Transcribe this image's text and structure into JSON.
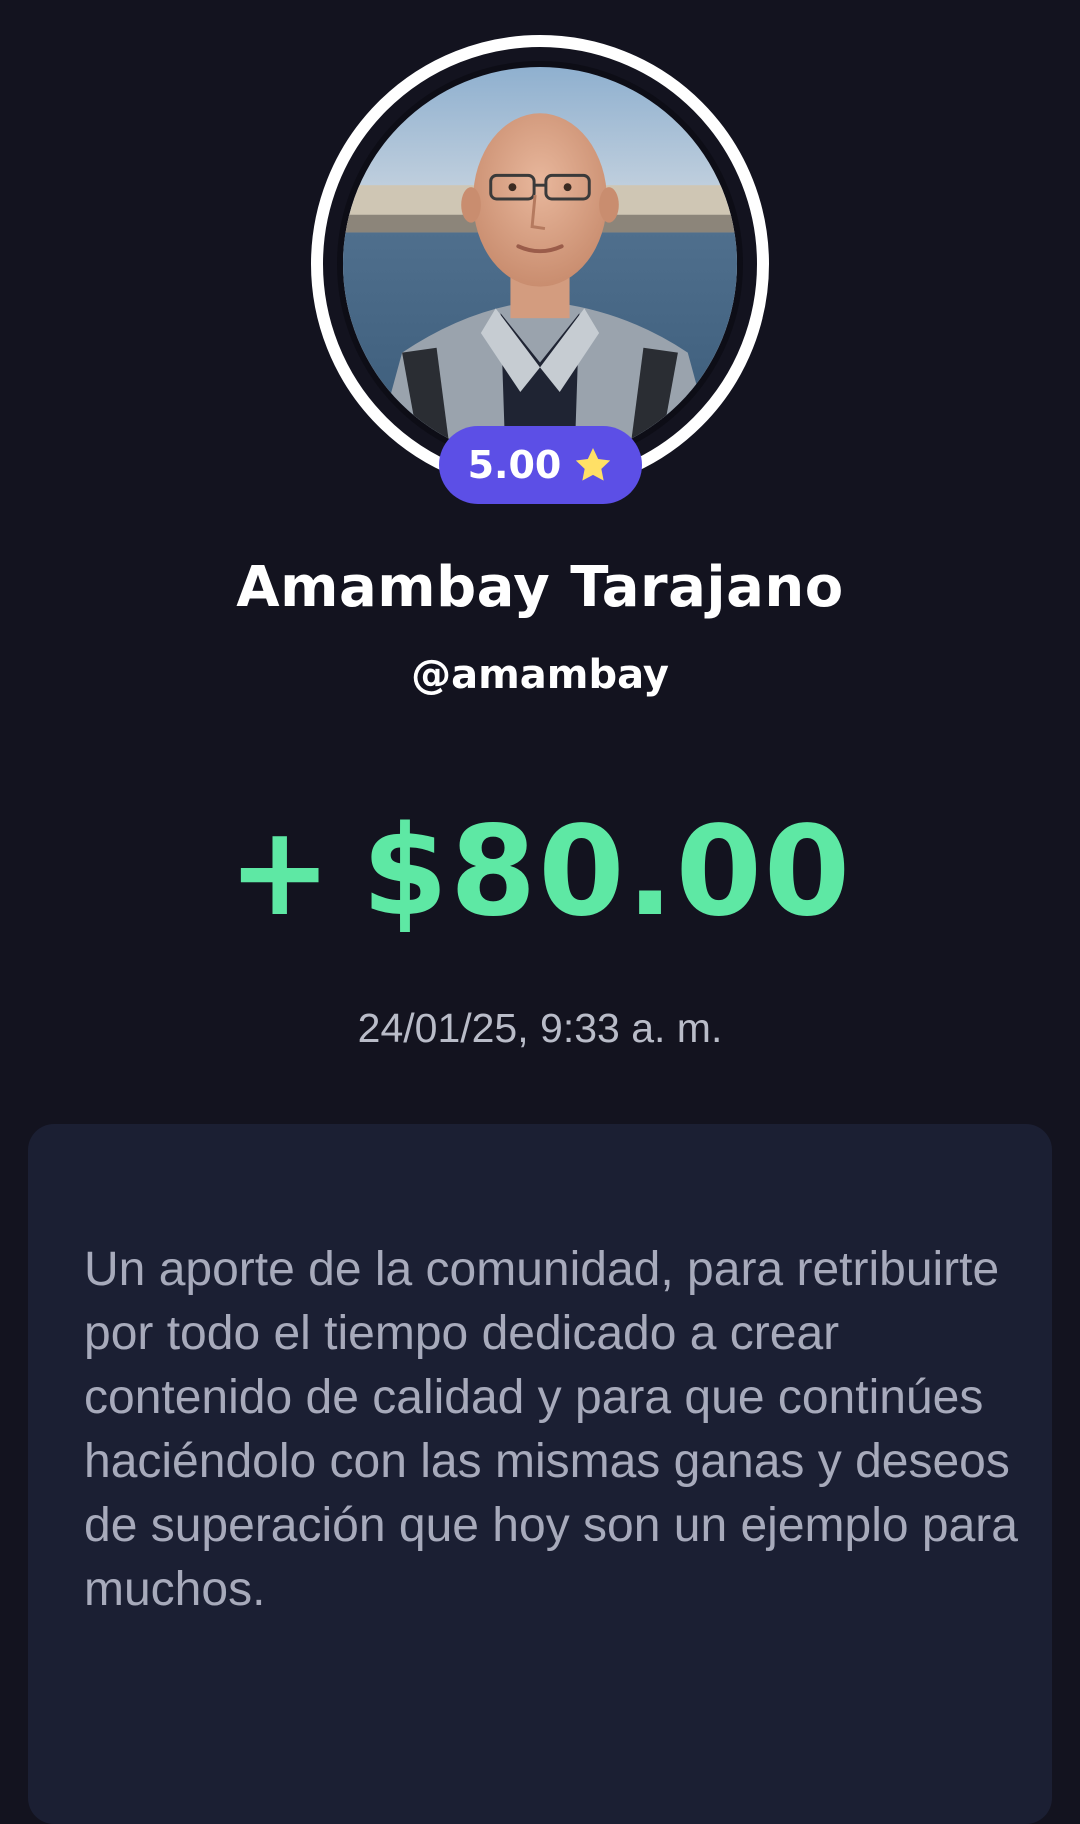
{
  "profile": {
    "avatar_alt": "profile photo",
    "rating": "5.00",
    "rating_icon": "star-icon",
    "name": "Amambay Tarajano",
    "handle": "@amambay"
  },
  "transaction": {
    "sign": "+",
    "amount": "$80.00",
    "timestamp": "24/01/25, 9:33 a. m.",
    "message": "Un aporte de la comunidad, para retribuirte por todo el tiempo dedicado a crear contenido de calidad y para que continúes haciéndolo con las mismas ganas y deseos de superación que hoy son un ejemplo para muchos."
  },
  "colors": {
    "background": "#13131f",
    "badge": "#5c4fe6",
    "amount": "#5ee8a4",
    "card": "#1b1f33",
    "star": "#ffe066"
  }
}
